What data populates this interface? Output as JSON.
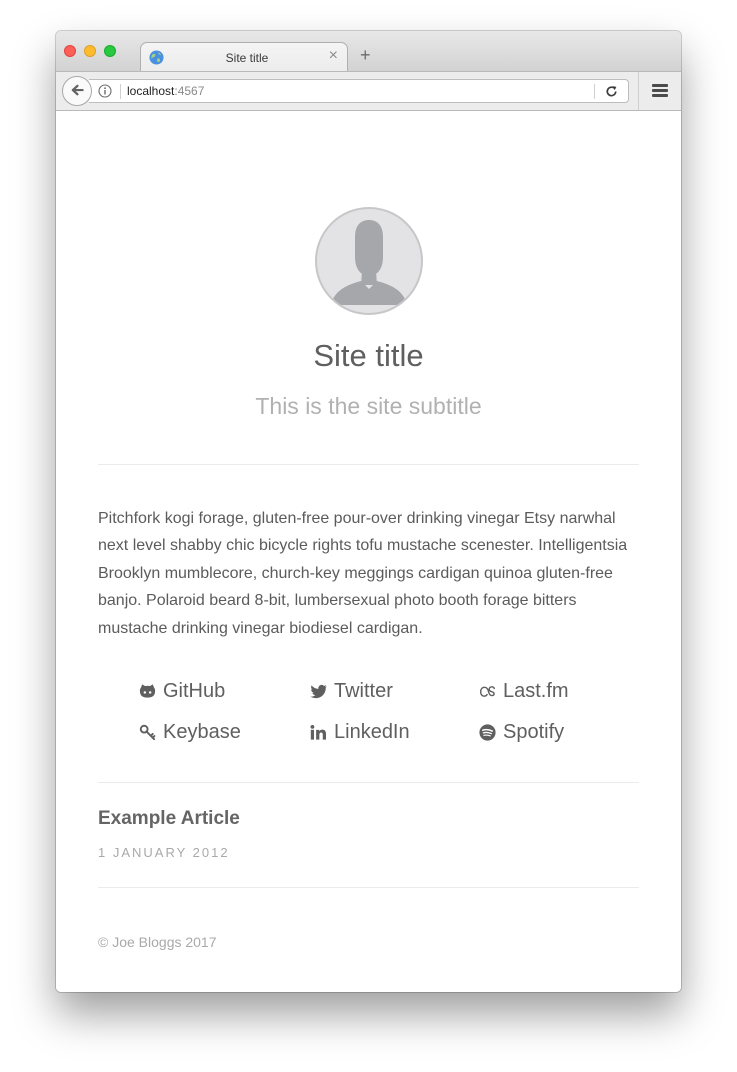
{
  "browser": {
    "tab_title": "Site title",
    "tab_close": "×",
    "new_tab": "+",
    "url_host": "localhost",
    "url_port": ":4567"
  },
  "site": {
    "title": "Site title",
    "subtitle": "This is the site subtitle",
    "intro": "Pitchfork kogi forage, gluten-free pour-over drinking vinegar Etsy narwhal next level shabby chic bicycle rights tofu mustache scenester. Intelligentsia Brooklyn mumblecore, church-key meggings cardigan quinoa gluten-free banjo. Polaroid beard 8-bit, lumbersexual photo booth forage bitters mustache drinking vinegar biodiesel cardigan."
  },
  "social": [
    {
      "label": "GitHub",
      "icon": "github-icon"
    },
    {
      "label": "Twitter",
      "icon": "twitter-icon"
    },
    {
      "label": "Last.fm",
      "icon": "lastfm-icon"
    },
    {
      "label": "Keybase",
      "icon": "key-icon"
    },
    {
      "label": "LinkedIn",
      "icon": "linkedin-icon"
    },
    {
      "label": "Spotify",
      "icon": "spotify-icon"
    }
  ],
  "articles": [
    {
      "title": "Example Article",
      "date": "1 JANUARY 2012"
    }
  ],
  "footer": {
    "text": "© Joe Bloggs 2017"
  },
  "colors": {
    "text": "#5f5f5f",
    "muted": "#a9a9a9",
    "traffic_red": "#fc5f57",
    "traffic_yellow": "#fdbc2e",
    "traffic_green": "#28c840"
  }
}
